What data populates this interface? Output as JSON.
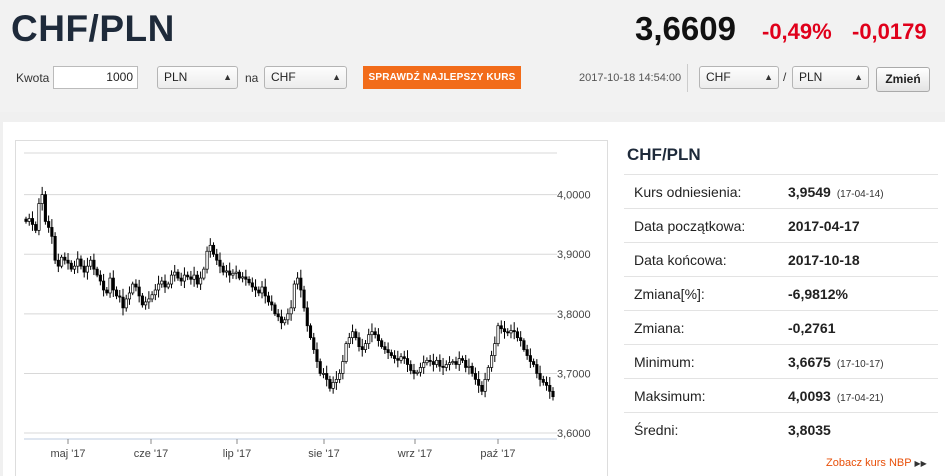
{
  "header": {
    "pair": "CHF/PLN",
    "rate": "3,6609",
    "change_pct": "-0,49%",
    "change_abs": "-0,0179"
  },
  "controls": {
    "amount_label": "Kwota",
    "amount_value": "1000",
    "from_currency": "PLN",
    "na_label": "na",
    "to_currency": "CHF",
    "best_rate_button": "SPRAWDŹ NAJLEPSZY KURS",
    "timestamp": "2017-10-18 14:54:00",
    "pair_base": "CHF",
    "slash": "/",
    "pair_quote": "PLN",
    "change_button": "Zmień"
  },
  "info": {
    "title": "CHF/PLN",
    "rows": [
      {
        "label": "Kurs odniesienia:",
        "value": "3,9549",
        "date": "(17-04-14)"
      },
      {
        "label": "Data początkowa:",
        "value": "2017-04-17",
        "date": ""
      },
      {
        "label": "Data końcowa:",
        "value": "2017-10-18",
        "date": ""
      },
      {
        "label": "Zmiana[%]:",
        "value": "-6,9812%",
        "date": ""
      },
      {
        "label": "Zmiana:",
        "value": "-0,2761",
        "date": ""
      },
      {
        "label": "Minimum:",
        "value": "3,6675",
        "date": "(17-10-17)"
      },
      {
        "label": "Maksimum:",
        "value": "4,0093",
        "date": "(17-04-21)"
      },
      {
        "label": "Średni:",
        "value": "3,8035",
        "date": ""
      }
    ],
    "nbp_link": "Zobacz kurs NBP"
  },
  "colors": {
    "accent_orange": "#f26c1a",
    "negative_red": "#e0001b",
    "title_navy": "#1e2a3a"
  },
  "chart_data": {
    "type": "candlestick",
    "title": "",
    "xlabel": "",
    "ylabel": "",
    "ylim": [
      3.59,
      4.09
    ],
    "yticks": [
      "4,0000",
      "3,9000",
      "3,8000",
      "3,7000",
      "3,6000"
    ],
    "ytick_values": [
      4.0,
      3.9,
      3.8,
      3.7,
      3.6
    ],
    "xticks": [
      "maj '17",
      "cze '17",
      "lip '17",
      "sie '17",
      "wrz '17",
      "paź '17"
    ],
    "x_range": [
      "2017-04-17",
      "2017-10-18"
    ],
    "grid": true,
    "legend": "none",
    "closes": [
      3.955,
      3.96,
      3.95,
      3.94,
      3.985,
      4.0,
      3.955,
      3.945,
      3.93,
      3.89,
      3.88,
      3.895,
      3.89,
      3.885,
      3.875,
      3.88,
      3.892,
      3.88,
      3.87,
      3.88,
      3.89,
      3.875,
      3.865,
      3.855,
      3.84,
      3.835,
      3.86,
      3.84,
      3.83,
      3.828,
      3.81,
      3.825,
      3.835,
      3.85,
      3.845,
      3.83,
      3.815,
      3.82,
      3.825,
      3.832,
      3.84,
      3.85,
      3.855,
      3.845,
      3.85,
      3.865,
      3.87,
      3.86,
      3.855,
      3.865,
      3.862,
      3.858,
      3.865,
      3.85,
      3.86,
      3.875,
      3.905,
      3.915,
      3.9,
      3.89,
      3.88,
      3.87,
      3.872,
      3.865,
      3.868,
      3.87,
      3.86,
      3.862,
      3.858,
      3.852,
      3.845,
      3.84,
      3.835,
      3.845,
      3.83,
      3.82,
      3.815,
      3.8,
      3.795,
      3.785,
      3.79,
      3.8,
      3.81,
      3.85,
      3.86,
      3.84,
      3.81,
      3.78,
      3.76,
      3.74,
      3.72,
      3.7,
      3.7,
      3.69,
      3.675,
      3.685,
      3.69,
      3.7,
      3.72,
      3.75,
      3.76,
      3.77,
      3.76,
      3.745,
      3.74,
      3.75,
      3.765,
      3.77,
      3.765,
      3.755,
      3.745,
      3.74,
      3.735,
      3.73,
      3.725,
      3.722,
      3.728,
      3.725,
      3.715,
      3.705,
      3.7,
      3.702,
      3.71,
      3.718,
      3.722,
      3.72,
      3.715,
      3.722,
      3.712,
      3.71,
      3.715,
      3.718,
      3.72,
      3.715,
      3.725,
      3.722,
      3.71,
      3.712,
      3.7,
      3.69,
      3.68,
      3.67,
      3.69,
      3.71,
      3.73,
      3.75,
      3.78,
      3.775,
      3.77,
      3.768,
      3.772,
      3.77,
      3.76,
      3.755,
      3.74,
      3.73,
      3.72,
      3.715,
      3.7,
      3.69,
      3.685,
      3.68,
      3.67,
      3.661
    ]
  }
}
